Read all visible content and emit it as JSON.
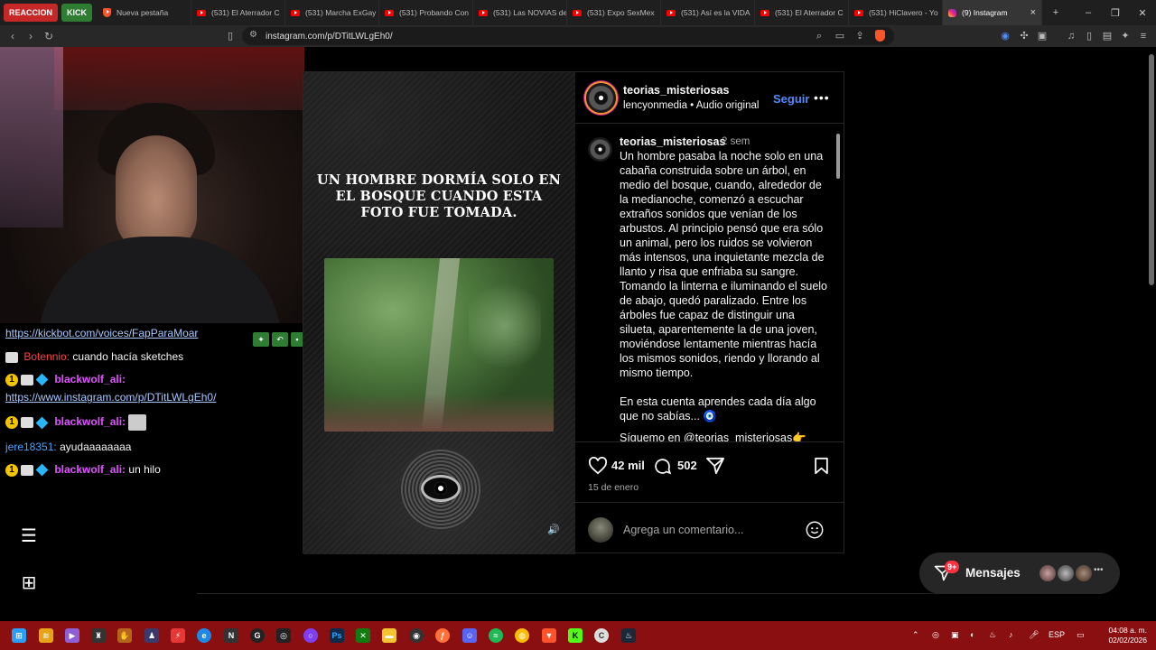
{
  "browser": {
    "pinned_tabs": [
      "REACCION",
      "KICK"
    ],
    "tabs": [
      {
        "label": "Nueva pestaña",
        "icon": "brave-icon"
      },
      {
        "label": "(531) El Aterrador C",
        "icon": "youtube-icon"
      },
      {
        "label": "(531) Marcha ExGay",
        "icon": "youtube-icon"
      },
      {
        "label": "(531) Probando Con",
        "icon": "youtube-icon"
      },
      {
        "label": "(531) Las NOVIAS de",
        "icon": "youtube-icon"
      },
      {
        "label": "(531) Expo SexMex",
        "icon": "youtube-icon"
      },
      {
        "label": "(531) Así es la VIDA",
        "icon": "youtube-icon"
      },
      {
        "label": "(531) El Aterrador C",
        "icon": "youtube-icon"
      },
      {
        "label": "(531) HiClavero - Yo",
        "icon": "youtube-icon"
      },
      {
        "label": "(9) Instagram",
        "icon": "instagram-icon",
        "active": true
      }
    ],
    "url": "instagram.com/p/DTitLWLgEh0/",
    "new_tab": "+",
    "window_controls": [
      "–",
      "❐",
      "✕"
    ]
  },
  "stream": {
    "chat": [
      {
        "user": "",
        "text": "https://kickbot.com/voices/FapParaMoar",
        "link": true
      },
      {
        "user": "Botennio:",
        "text": "cuando hacía sketches"
      },
      {
        "user": "blackwolf_ali:",
        "text": ""
      },
      {
        "user": "",
        "text": "https://www.instagram.com/p/DTitLWLgEh0/",
        "link": true
      },
      {
        "user": "blackwolf_ali:",
        "text": ""
      },
      {
        "user": "jere18351:",
        "text": "ayudaaaaaaaa"
      },
      {
        "user": "blackwolf_ali:",
        "text": "un hilo"
      }
    ],
    "badge_number": "1"
  },
  "post": {
    "media_headline": "UN HOMBRE DORMÍA SOLO EN EL BOSQUE CUANDO ESTA FOTO FUE TOMADA.",
    "author": "teorias_misteriosas",
    "subtitle": "lencyonmedia • Audio original",
    "follow_label": "Seguir",
    "more_label": "•••",
    "caption_time": "2 sem",
    "caption": "Un hombre pasaba la noche solo en una cabaña construida sobre un árbol, en medio del bosque, cuando, alrededor de la medianoche, comenzó a escuchar extraños sonidos que venían de los arbustos. Al principio pensó que era sólo un animal, pero los ruidos se volvieron más intensos, una inquietante mezcla de llanto y risa que enfriaba su sangre. Tomando la linterna e iluminando el suelo de abajo, quedó paralizado. Entre los árboles fue capaz de distinguir una silueta, aparentemente la de una joven, moviéndose lentamente mientras hacía los mismos sonidos, riendo y llorando al mismo tiempo.",
    "caption_extra": "En esta cuenta aprendes cada día algo que no sabías... 🧿",
    "caption_follow": "Síguemo en @teorias_misteriosas👉",
    "likes": "42 mil",
    "comments": "502",
    "date": "15 de enero",
    "comment_placeholder": "Agrega un comentario..."
  },
  "messages": {
    "label": "Mensajes",
    "badge": "9+"
  },
  "taskbar": {
    "language": "ESP",
    "time": "04:08 a. m.",
    "date": "02/02/2026"
  },
  "colors": {
    "accent_link": "#4f8cff",
    "taskbar": "#8a0f10",
    "notification": "#ff3040"
  }
}
